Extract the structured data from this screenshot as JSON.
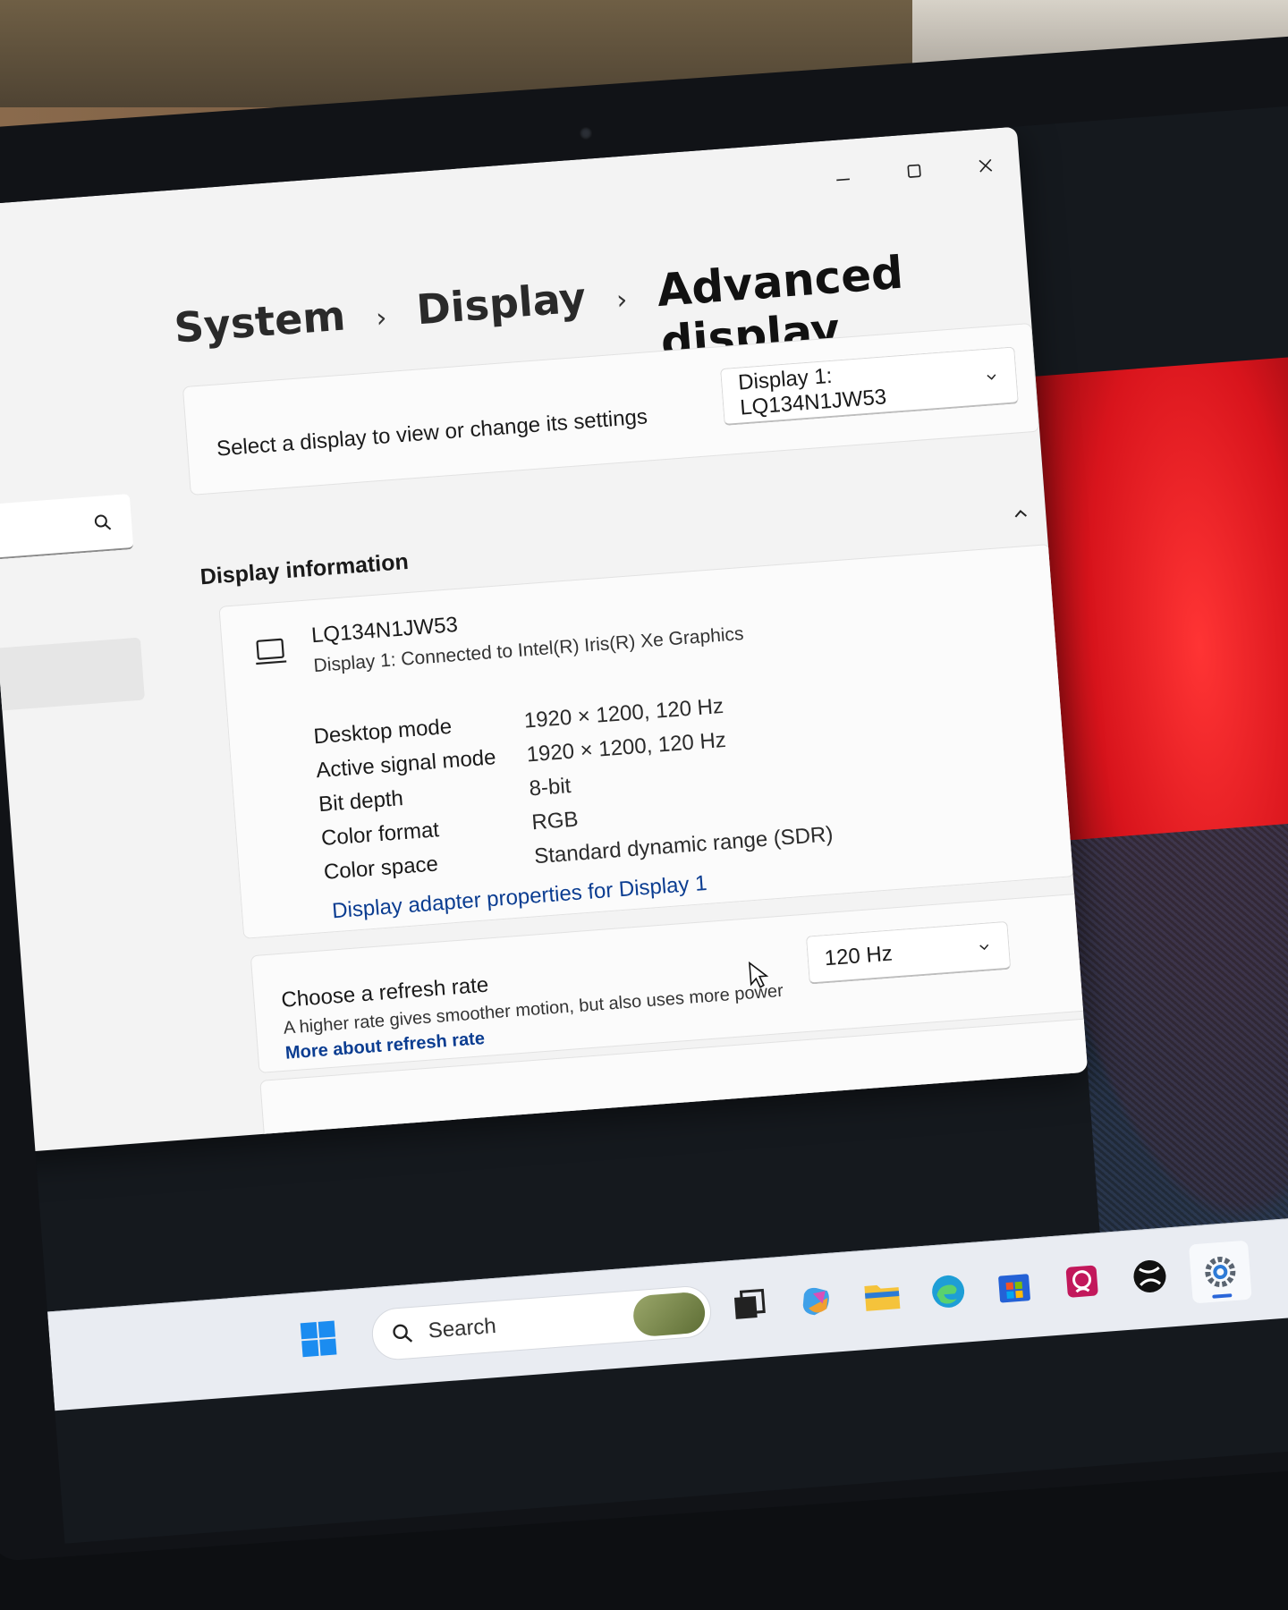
{
  "window": {
    "controls": {
      "minimize": "minimize-icon",
      "maximize": "maximize-icon",
      "close": "close-icon"
    }
  },
  "breadcrumb": {
    "items": [
      "System",
      "Display",
      "Advanced display"
    ],
    "separator": "›"
  },
  "display_select": {
    "label": "Select a display to view or change its settings",
    "selected": "Display 1: LQ134N1JW53"
  },
  "display_information": {
    "title": "Display information",
    "monitor_name": "LQ134N1JW53",
    "connection": "Display 1: Connected to Intel(R) Iris(R) Xe Graphics",
    "specs": [
      {
        "label": "Desktop mode",
        "value": "1920 × 1200, 120 Hz"
      },
      {
        "label": "Active signal mode",
        "value": "1920 × 1200, 120 Hz"
      },
      {
        "label": "Bit depth",
        "value": "8-bit"
      },
      {
        "label": "Color format",
        "value": "RGB"
      },
      {
        "label": "Color space",
        "value": "Standard dynamic range (SDR)"
      }
    ],
    "adapter_link": "Display adapter properties for Display 1"
  },
  "refresh_rate": {
    "title": "Choose a refresh rate",
    "description": "A higher rate gives smoother motion, but also uses more power",
    "link": "More about refresh rate",
    "selected": "120 Hz"
  },
  "taskbar": {
    "search_label": "Search",
    "apps": [
      "start-icon",
      "task-view-icon",
      "copilot-icon",
      "file-explorer-icon",
      "edge-icon",
      "store-icon",
      "teams-icon",
      "xbox-icon",
      "settings-icon"
    ],
    "colors": {
      "start": "#1b8cf0",
      "edge": "#1e9ed6",
      "explorer": "#f5c33b",
      "store": "#2461d6",
      "teams": "#c2185b",
      "active_indicator": "#2a66d9"
    }
  },
  "colors": {
    "link": "#0b3d91",
    "window_bg": "#f3f3f3",
    "card_bg": "#fbfbfb"
  }
}
